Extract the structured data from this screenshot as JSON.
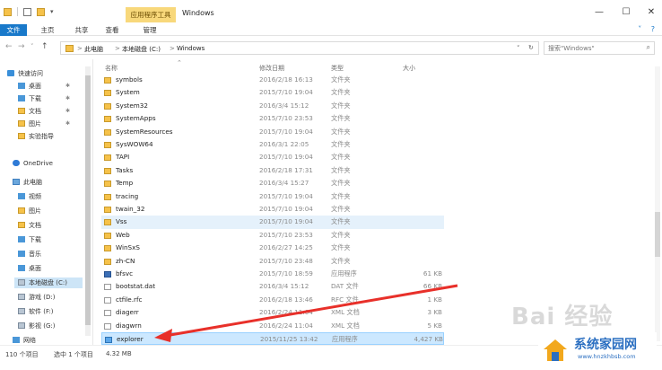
{
  "window": {
    "title": "Windows",
    "context_tab": "应用程序工具",
    "controls": {
      "minimize": "—",
      "maximize": "☐",
      "close": "✕"
    }
  },
  "ribbon": {
    "tabs": [
      "文件",
      "主页",
      "共享",
      "查看",
      "管理"
    ],
    "expand_glyph": "˅",
    "help_glyph": "?"
  },
  "address": {
    "crumbs": [
      "此电脑",
      "本地磁盘 (C:)",
      "Windows"
    ],
    "separator": ">",
    "refresh_glyph": "↻",
    "dropdown_glyph": "˅"
  },
  "search": {
    "placeholder": "搜索\"Windows\"",
    "icon": "search-icon"
  },
  "columns": {
    "name": "名称",
    "date": "修改日期",
    "type": "类型",
    "size": "大小"
  },
  "sidebar": {
    "items": [
      {
        "label": "快速访问",
        "icon": "quick-access-icon"
      },
      {
        "label": "桌面",
        "icon": "desktop-icon",
        "pinned": true
      },
      {
        "label": "下载",
        "icon": "download-icon",
        "pinned": true
      },
      {
        "label": "文档",
        "icon": "documents-icon",
        "pinned": true
      },
      {
        "label": "图片",
        "icon": "pictures-icon",
        "pinned": true
      },
      {
        "label": "实验指导",
        "icon": "folder-icon"
      },
      {
        "label": "OneDrive",
        "icon": "onedrive-icon"
      },
      {
        "label": "此电脑",
        "icon": "this-pc-icon"
      },
      {
        "label": "视频",
        "icon": "videos-icon"
      },
      {
        "label": "图片",
        "icon": "pictures-icon"
      },
      {
        "label": "文档",
        "icon": "documents-icon"
      },
      {
        "label": "下载",
        "icon": "download-icon"
      },
      {
        "label": "音乐",
        "icon": "music-icon"
      },
      {
        "label": "桌面",
        "icon": "desktop-icon"
      },
      {
        "label": "本地磁盘 (C:)",
        "icon": "drive-icon",
        "selected": true
      },
      {
        "label": "游戏 (D:)",
        "icon": "drive-icon"
      },
      {
        "label": "软件 (F:)",
        "icon": "drive-icon"
      },
      {
        "label": "影视 (G:)",
        "icon": "drive-icon"
      },
      {
        "label": "网络",
        "icon": "network-icon"
      }
    ],
    "pin_glyph": "📌"
  },
  "files": [
    {
      "name": "symbols",
      "date": "2016/2/18 16:13",
      "type": "文件夹",
      "size": "",
      "kind": "folder"
    },
    {
      "name": "System",
      "date": "2015/7/10 19:04",
      "type": "文件夹",
      "size": "",
      "kind": "folder"
    },
    {
      "name": "System32",
      "date": "2016/3/4 15:12",
      "type": "文件夹",
      "size": "",
      "kind": "folder"
    },
    {
      "name": "SystemApps",
      "date": "2015/7/10 23:53",
      "type": "文件夹",
      "size": "",
      "kind": "folder"
    },
    {
      "name": "SystemResources",
      "date": "2015/7/10 19:04",
      "type": "文件夹",
      "size": "",
      "kind": "folder"
    },
    {
      "name": "SysWOW64",
      "date": "2016/3/1 22:05",
      "type": "文件夹",
      "size": "",
      "kind": "folder"
    },
    {
      "name": "TAPI",
      "date": "2015/7/10 19:04",
      "type": "文件夹",
      "size": "",
      "kind": "folder"
    },
    {
      "name": "Tasks",
      "date": "2016/2/18 17:31",
      "type": "文件夹",
      "size": "",
      "kind": "folder"
    },
    {
      "name": "Temp",
      "date": "2016/3/4 15:27",
      "type": "文件夹",
      "size": "",
      "kind": "folder"
    },
    {
      "name": "tracing",
      "date": "2015/7/10 19:04",
      "type": "文件夹",
      "size": "",
      "kind": "folder"
    },
    {
      "name": "twain_32",
      "date": "2015/7/10 19:04",
      "type": "文件夹",
      "size": "",
      "kind": "folder"
    },
    {
      "name": "Vss",
      "date": "2015/7/10 19:04",
      "type": "文件夹",
      "size": "",
      "kind": "folder",
      "highlight": true
    },
    {
      "name": "Web",
      "date": "2015/7/10 23:53",
      "type": "文件夹",
      "size": "",
      "kind": "folder"
    },
    {
      "name": "WinSxS",
      "date": "2016/2/27 14:25",
      "type": "文件夹",
      "size": "",
      "kind": "folder"
    },
    {
      "name": "zh-CN",
      "date": "2015/7/10 23:48",
      "type": "文件夹",
      "size": "",
      "kind": "folder"
    },
    {
      "name": "bfsvc",
      "date": "2015/7/10 18:59",
      "type": "应用程序",
      "size": "61 KB",
      "kind": "exe"
    },
    {
      "name": "bootstat.dat",
      "date": "2016/3/4 15:12",
      "type": "DAT 文件",
      "size": "66 KB",
      "kind": "file"
    },
    {
      "name": "ctfile.rfc",
      "date": "2016/2/18 13:46",
      "type": "RFC 文件",
      "size": "1 KB",
      "kind": "file"
    },
    {
      "name": "diagerr",
      "date": "2016/2/24 11:04",
      "type": "XML 文档",
      "size": "3 KB",
      "kind": "file"
    },
    {
      "name": "diagwrn",
      "date": "2016/2/24 11:04",
      "type": "XML 文档",
      "size": "5 KB",
      "kind": "file"
    },
    {
      "name": "explorer",
      "date": "2015/11/25 13:42",
      "type": "应用程序",
      "size": "4,427 KB",
      "kind": "explorer",
      "selected": true
    }
  ],
  "status": {
    "count": "110 个项目",
    "selected": "选中 1 个项目",
    "size": "4.32 MB"
  },
  "watermark": {
    "baidu": "Bai 经验",
    "site_title": "系统家园网",
    "site_url": "www.hnzkhbsb.com"
  },
  "colors": {
    "accent": "#1979ca",
    "arrow": "#e8302a",
    "selected_row": "#cce8ff",
    "folder": "#f6c24a"
  }
}
